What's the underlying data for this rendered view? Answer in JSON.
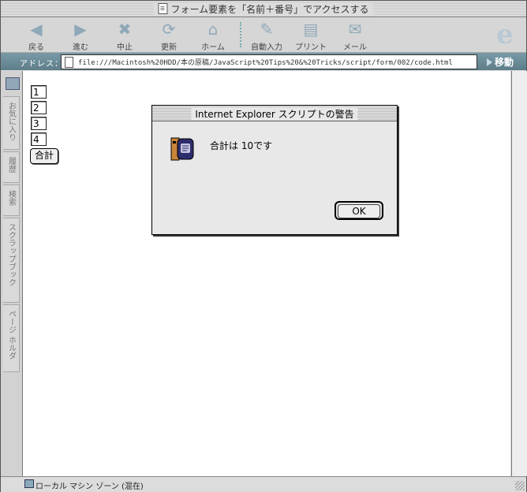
{
  "window": {
    "title": "フォーム要素を「名前＋番号」でアクセスする"
  },
  "toolbar": {
    "back_label": "戻る",
    "forward_label": "進む",
    "stop_label": "中止",
    "refresh_label": "更新",
    "home_label": "ホーム",
    "autofill_label": "自動入力",
    "print_label": "プリント",
    "mail_label": "メール"
  },
  "address_bar": {
    "label": "アドレス：",
    "url": "file:///Macintosh%20HDD/本の原稿/JavaScript%20Tips%20&%20Tricks/script/form/002/code.html",
    "go_label": "移動"
  },
  "sidebar": {
    "tabs": [
      {
        "label": "お気に入り"
      },
      {
        "label": "履歴"
      },
      {
        "label": "検索"
      },
      {
        "label": "スクラップブック"
      },
      {
        "label": "ページ ホルダ"
      }
    ]
  },
  "form": {
    "fields": [
      {
        "value": "1"
      },
      {
        "value": "2"
      },
      {
        "value": "3"
      },
      {
        "value": "4"
      }
    ],
    "sum_button_label": "合計"
  },
  "status": {
    "text": "ローカル マシン ゾーン (混在)"
  },
  "dialog": {
    "title": "Internet Explorer スクリプトの警告",
    "message": "合計は 10です",
    "ok_label": "OK"
  }
}
